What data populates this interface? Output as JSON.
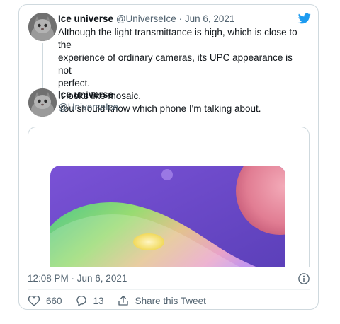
{
  "quoted_tweet": {
    "author_name": "Ice universe",
    "author_handle": "@UniverseIce",
    "separator": "·",
    "date": "Jun 6, 2021",
    "lines": [
      "Although the light transmittance is high, which is close to the",
      "experience of ordinary cameras, its UPC appearance is not",
      "perfect.",
      "It looks like mosaic.",
      "You should know which phone I'm talking about."
    ]
  },
  "tweet": {
    "author_name": "Ice universe",
    "author_handle": "@UniverseIce",
    "timestamp": "12:08 PM · Jun 6, 2021"
  },
  "actions": {
    "likes": "660",
    "replies": "13",
    "share_label": "Share this Tweet"
  },
  "colors": {
    "brand": "#1d9bf0",
    "text": "#0f1419",
    "muted": "#536471",
    "border": "#cfd9de"
  },
  "icons": [
    "twitter-bird-icon",
    "info-icon",
    "heart-icon",
    "reply-icon",
    "share-icon"
  ]
}
